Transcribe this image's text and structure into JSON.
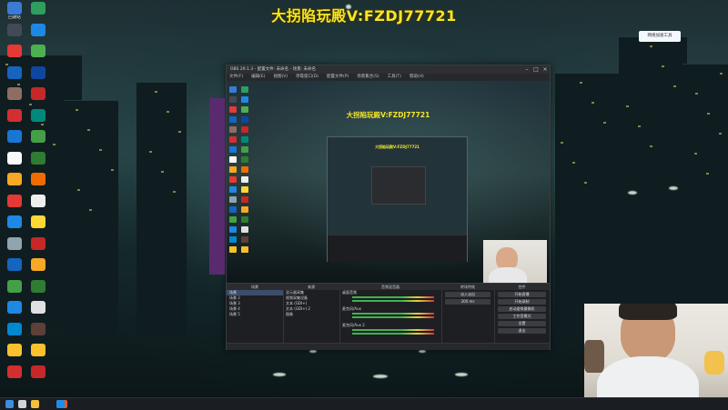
{
  "stream_banner": "大拐陷玩殿V:FZDJ77721",
  "desktop": {
    "icons": [
      {
        "label": "回收站",
        "color": "#3a7bd5"
      },
      {
        "label": "",
        "color": "#2f9e5e"
      },
      {
        "label": "",
        "color": "#444a55"
      },
      {
        "label": "",
        "color": "#1e88e5"
      },
      {
        "label": "",
        "color": "#e53935"
      },
      {
        "label": "",
        "color": "#4caf50"
      },
      {
        "label": "",
        "color": "#1565c0"
      },
      {
        "label": "",
        "color": "#0d47a1"
      },
      {
        "label": "",
        "color": "#8d6e63"
      },
      {
        "label": "",
        "color": "#c62828"
      },
      {
        "label": "",
        "color": "#d32f2f"
      },
      {
        "label": "",
        "color": "#00897b"
      },
      {
        "label": "",
        "color": "#1976d2"
      },
      {
        "label": "",
        "color": "#43a047"
      },
      {
        "label": "",
        "color": "#fafafa"
      },
      {
        "label": "",
        "color": "#2e7d32"
      },
      {
        "label": "",
        "color": "#f9a825"
      },
      {
        "label": "",
        "color": "#ef6c00"
      },
      {
        "label": "",
        "color": "#e53935"
      },
      {
        "label": "",
        "color": "#eeeeee"
      },
      {
        "label": "",
        "color": "#1e88e5"
      },
      {
        "label": "",
        "color": "#fdd835"
      },
      {
        "label": "",
        "color": "#90a4ae"
      },
      {
        "label": "",
        "color": "#c62828"
      },
      {
        "label": "",
        "color": "#1565c0"
      },
      {
        "label": "",
        "color": "#f9a825"
      },
      {
        "label": "",
        "color": "#43a047"
      },
      {
        "label": "",
        "color": "#2e7d32"
      },
      {
        "label": "",
        "color": "#1e88e5"
      },
      {
        "label": "",
        "color": "#e0e0e0"
      },
      {
        "label": "",
        "color": "#0288d1"
      },
      {
        "label": "",
        "color": "#5d4037"
      },
      {
        "label": "",
        "color": "#fbc02d"
      },
      {
        "label": "",
        "color": "#fbc02d"
      },
      {
        "label": "",
        "color": "#d32f2f"
      },
      {
        "label": "",
        "color": "#c62828"
      }
    ],
    "widget_label": "网络加速工具"
  },
  "obs": {
    "title": "OBS 29.1.3 - 配置文件: 未命名 - 场景: 未命名",
    "menu": [
      "文件(F)",
      "编辑(E)",
      "视图(V)",
      "停靠窗口(D)",
      "配置文件(P)",
      "场景集合(S)",
      "工具(T)",
      "帮助(H)"
    ],
    "docks": {
      "scenes": {
        "title": "场景",
        "items": [
          "场景",
          "场景 2",
          "场景 3",
          "场景 4",
          "场景 5"
        ]
      },
      "sources": {
        "title": "来源",
        "items": [
          "显示器采集",
          "视频采集设备",
          "文本 (GDI+)",
          "文本 (GDI+) 2",
          "图像"
        ]
      },
      "mixer": {
        "title": "音频混音器",
        "tracks": [
          "桌面音频",
          "麦克风/Aux",
          "麦克风/Aux 2"
        ]
      },
      "transitions": {
        "title": "转场特效",
        "type": "淡入淡出",
        "duration": "300 ms"
      },
      "controls": {
        "title": "控件",
        "buttons": [
          "开始直播",
          "开始录制",
          "启动虚拟摄像机",
          "工作室模式",
          "设置",
          "退出"
        ]
      }
    }
  },
  "taskbar": {
    "items": [
      "start",
      "search",
      "explorer",
      "obs",
      "edge"
    ]
  }
}
